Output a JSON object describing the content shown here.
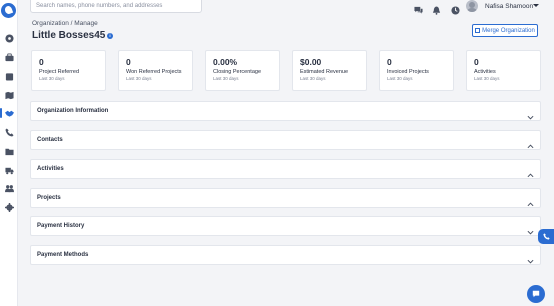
{
  "search": {
    "placeholder": "Search names, phone numbers, and addresses"
  },
  "header": {
    "user_name": "Nafisa Shamoon"
  },
  "sidebar": {
    "items": [
      {
        "icon": "dashboard-icon"
      },
      {
        "icon": "briefcase-icon"
      },
      {
        "icon": "calendar-icon"
      },
      {
        "icon": "map-icon"
      },
      {
        "icon": "handshake-icon",
        "active": true
      },
      {
        "icon": "phone-icon"
      },
      {
        "icon": "folder-icon"
      },
      {
        "icon": "truck-icon"
      },
      {
        "icon": "users-icon"
      },
      {
        "icon": "gear-icon"
      }
    ]
  },
  "page": {
    "breadcrumb": "Organization / Manage",
    "title": "Little Bosses45",
    "merge_label": "Merge Organization"
  },
  "stats": [
    {
      "value": "0",
      "label": "Project Referred",
      "period": "Last 30 days"
    },
    {
      "value": "0",
      "label": "Won Referred Projects",
      "period": "Last 30 days"
    },
    {
      "value": "0.00%",
      "label": "Closing Percentage",
      "period": "Last 30 days"
    },
    {
      "value": "$0.00",
      "label": "Estimated Revenue",
      "period": "Last 30 days"
    },
    {
      "value": "0",
      "label": "Invoiced Projects",
      "period": "Last 30 days"
    },
    {
      "value": "0",
      "label": "Activities",
      "period": "Last 30 days"
    }
  ],
  "panels": [
    {
      "title": "Organization Information",
      "expanded": false
    },
    {
      "title": "Contacts",
      "expanded": true
    },
    {
      "title": "Activities",
      "expanded": true
    },
    {
      "title": "Projects",
      "expanded": true
    },
    {
      "title": "Payment History",
      "expanded": false
    },
    {
      "title": "Payment Methods",
      "expanded": false
    }
  ],
  "colors": {
    "accent": "#2b6cd1",
    "background": "#f3f4f7"
  }
}
